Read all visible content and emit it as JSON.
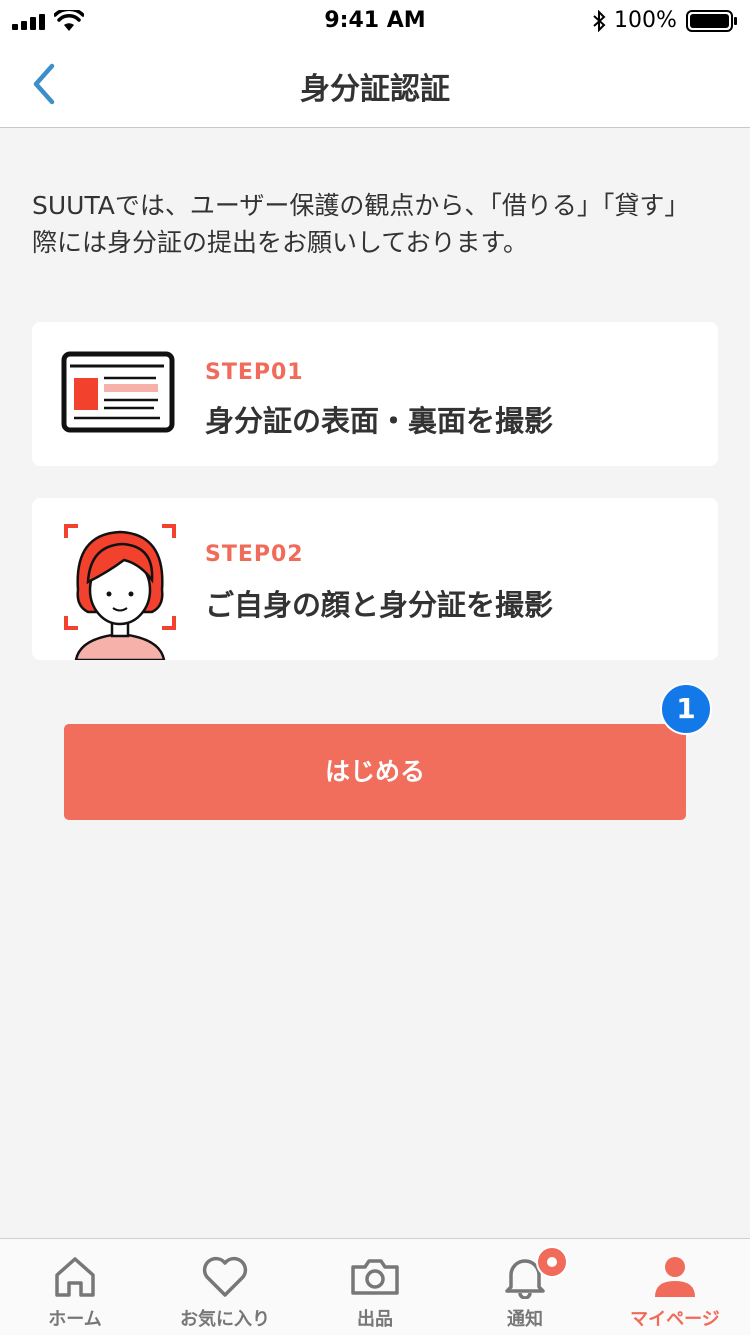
{
  "status_bar": {
    "time": "9:41 AM",
    "battery": "100%"
  },
  "nav": {
    "title": "身分証認証"
  },
  "intro": {
    "text": "SUUTAでは、ユーザー保護の観点から、「借りる」「貸す」際には身分証の提出をお願いしております。"
  },
  "steps": [
    {
      "label": "STEP01",
      "title": "身分証の表面・裏面を撮影",
      "icon": "id-card-illustration"
    },
    {
      "label": "STEP02",
      "title": "ご自身の顔と身分証を撮影",
      "icon": "face-selfie-illustration"
    }
  ],
  "start_button": {
    "label": "はじめる"
  },
  "badge": {
    "text": "1"
  },
  "tabs": [
    {
      "label": "ホーム",
      "icon": "home-icon"
    },
    {
      "label": "お気に入り",
      "icon": "heart-icon"
    },
    {
      "label": "出品",
      "icon": "camera-icon"
    },
    {
      "label": "通知",
      "icon": "bell-icon"
    },
    {
      "label": "マイページ",
      "icon": "user-icon"
    }
  ],
  "colors": {
    "accent": "#f06b5a",
    "button": "#f16d5c",
    "badge": "#1479e8",
    "back": "#3d8ec9"
  }
}
